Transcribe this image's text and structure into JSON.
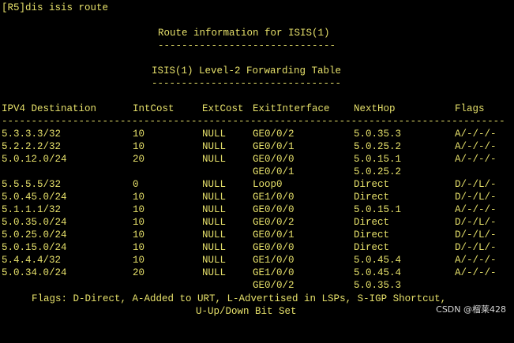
{
  "terminal": {
    "prompt_command": "[R5]dis isis route",
    "title": "Route information for ISIS(1)",
    "title_rule": "------------------------------",
    "subtitle": "ISIS(1) Level-2 Forwarding Table",
    "subtitle_rule": "--------------------------------",
    "header_rule": "----------------------------------------------------------------------------------------",
    "columns": {
      "destination": "IPV4 Destination",
      "intcost": "IntCost",
      "extcost": "ExtCost",
      "exitif": "ExitInterface",
      "nexthop": "NextHop",
      "flags": "Flags"
    },
    "rows": [
      {
        "dest": "5.3.3.3/32",
        "intcost": "10",
        "extcost": "NULL",
        "exitif": "GE0/0/2",
        "nexthop": "5.0.35.3",
        "flags": "A/-/-/-"
      },
      {
        "dest": "5.2.2.2/32",
        "intcost": "10",
        "extcost": "NULL",
        "exitif": "GE0/0/1",
        "nexthop": "5.0.25.2",
        "flags": "A/-/-/-"
      },
      {
        "dest": "5.0.12.0/24",
        "intcost": "20",
        "extcost": "NULL",
        "exitif": "GE0/0/0",
        "nexthop": "5.0.15.1",
        "flags": "A/-/-/-"
      },
      {
        "dest": "",
        "intcost": "",
        "extcost": "",
        "exitif": "GE0/0/1",
        "nexthop": "5.0.25.2",
        "flags": ""
      },
      {
        "dest": "5.5.5.5/32",
        "intcost": "0",
        "extcost": "NULL",
        "exitif": "Loop0",
        "nexthop": "Direct",
        "flags": "D/-/L/-"
      },
      {
        "dest": "5.0.45.0/24",
        "intcost": "10",
        "extcost": "NULL",
        "exitif": "GE1/0/0",
        "nexthop": "Direct",
        "flags": "D/-/L/-"
      },
      {
        "dest": "5.1.1.1/32",
        "intcost": "10",
        "extcost": "NULL",
        "exitif": "GE0/0/0",
        "nexthop": "5.0.15.1",
        "flags": "A/-/-/-"
      },
      {
        "dest": "5.0.35.0/24",
        "intcost": "10",
        "extcost": "NULL",
        "exitif": "GE0/0/2",
        "nexthop": "Direct",
        "flags": "D/-/L/-"
      },
      {
        "dest": "5.0.25.0/24",
        "intcost": "10",
        "extcost": "NULL",
        "exitif": "GE0/0/1",
        "nexthop": "Direct",
        "flags": "D/-/L/-"
      },
      {
        "dest": "5.0.15.0/24",
        "intcost": "10",
        "extcost": "NULL",
        "exitif": "GE0/0/0",
        "nexthop": "Direct",
        "flags": "D/-/L/-"
      },
      {
        "dest": "5.4.4.4/32",
        "intcost": "10",
        "extcost": "NULL",
        "exitif": "GE1/0/0",
        "nexthop": "5.0.45.4",
        "flags": "A/-/-/-"
      },
      {
        "dest": "5.0.34.0/24",
        "intcost": "20",
        "extcost": "NULL",
        "exitif": "GE1/0/0",
        "nexthop": "5.0.45.4",
        "flags": "A/-/-/-"
      },
      {
        "dest": "",
        "intcost": "",
        "extcost": "",
        "exitif": "GE0/0/2",
        "nexthop": "5.0.35.3",
        "flags": ""
      }
    ],
    "legend_line1": "Flags: D-Direct, A-Added to URT, L-Advertised in LSPs, S-IGP Shortcut,",
    "legend_line2": "U-Up/Down Bit Set"
  },
  "watermark": "CSDN @榴莱428",
  "colors": {
    "background": "#000000",
    "text": "#e6e06a",
    "watermark": "#d8d8d8"
  }
}
